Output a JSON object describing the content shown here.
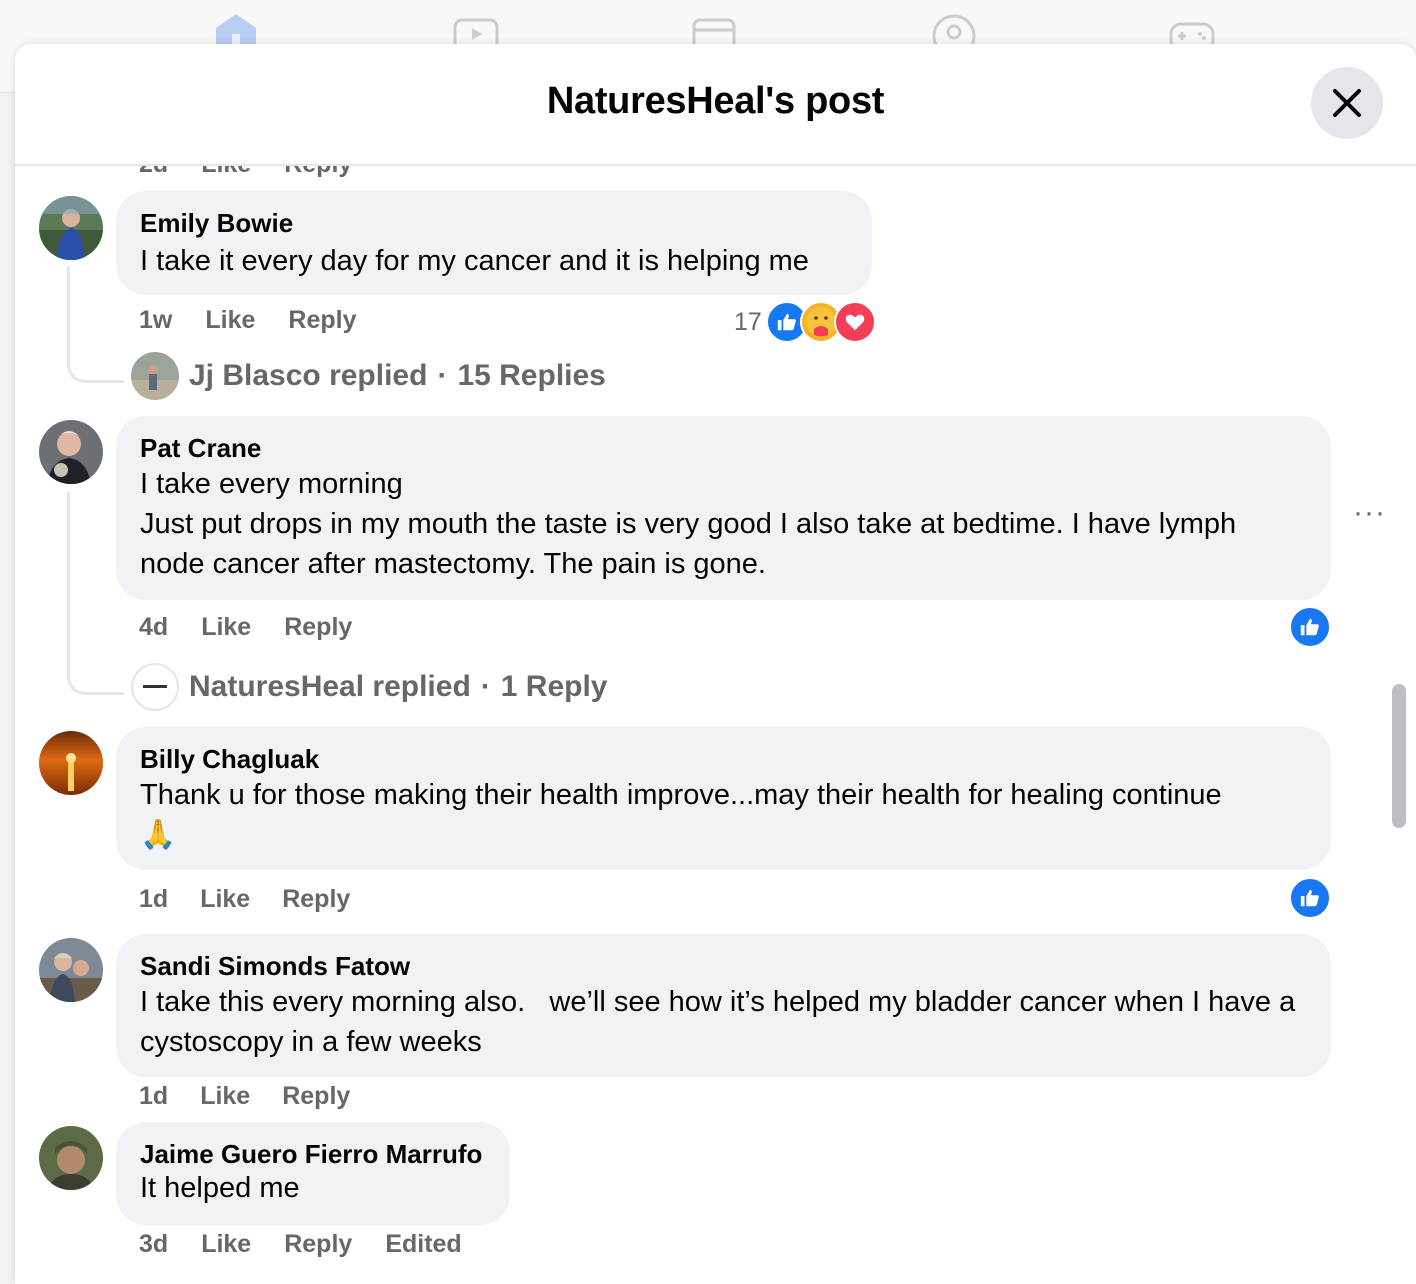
{
  "modal": {
    "title": "NaturesHeal's post",
    "close_label": "Close"
  },
  "top_cut_meta": {
    "time": "2d",
    "like": "Like",
    "reply": "Reply"
  },
  "comments": [
    {
      "author": "Emily Bowie",
      "text": "I take it every day for my cancer and it is helping me",
      "time": "1w",
      "like": "Like",
      "reply": "Reply",
      "reaction_count": "17",
      "replies": {
        "author_line": "Jj Blasco replied",
        "count": "15 Replies"
      }
    },
    {
      "author": "Pat Crane",
      "text": "I take every morning\nJust put drops in my mouth the taste is very good I also take at bedtime. I have lymph node cancer after mastectomy. The pain is gone.",
      "time": "4d",
      "like": "Like",
      "reply": "Reply",
      "replies": {
        "author_line": "NaturesHeal replied",
        "count": "1 Reply"
      }
    },
    {
      "author": "Billy Chagluak",
      "text": "Thank u for those making their health improve...may their health for healing continue\n🙏",
      "time": "1d",
      "like": "Like",
      "reply": "Reply"
    },
    {
      "author": "Sandi Simonds Fatow",
      "text": "I take this every morning also.   we’ll see how it’s helped my bladder cancer when I have a cystoscopy in a few weeks",
      "time": "1d",
      "like": "Like",
      "reply": "Reply"
    },
    {
      "author": "Jaime Guero Fierro Marrufo",
      "text": "It helped me",
      "time": "3d",
      "like": "Like",
      "reply": "Reply",
      "edited": "Edited"
    }
  ],
  "separator": "·",
  "more_options": "···",
  "colors": {
    "like_blue": "#1877f2",
    "bubble_bg": "#f0f2f5",
    "meta_gray": "#65676b",
    "love_red": "#f33e58",
    "care_yellow": "#f7b125"
  },
  "icons": {
    "close": "close-icon",
    "like": "thumbs-up-icon",
    "care": "care-emoji-icon",
    "love": "heart-icon",
    "more": "more-options-icon"
  }
}
